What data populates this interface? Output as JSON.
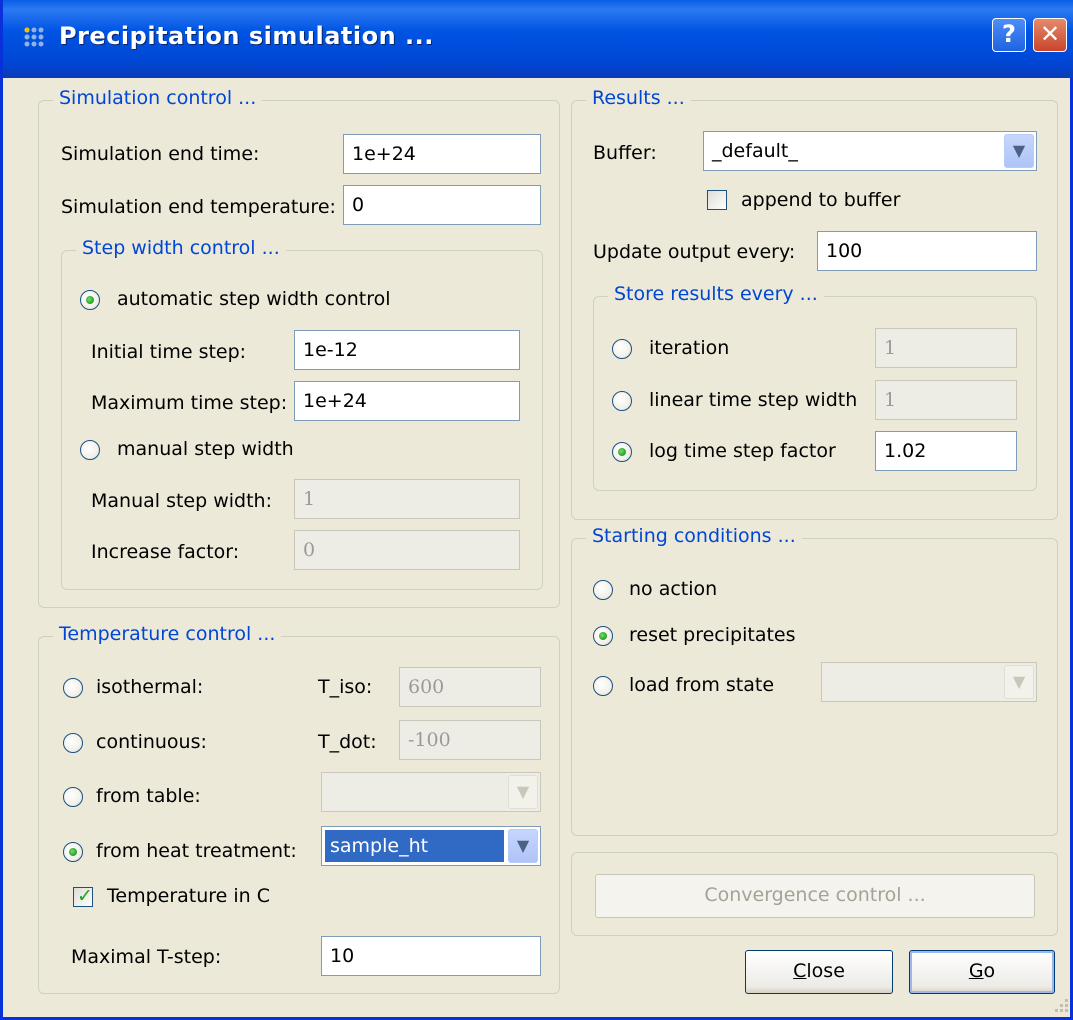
{
  "window": {
    "title": "Precipitation simulation ...",
    "help_label": "?",
    "close_label": "✕"
  },
  "simulation_control": {
    "legend": "Simulation control ...",
    "end_time_label": "Simulation end time:",
    "end_time_value": "1e+24",
    "end_temp_label": "Simulation end temperature:",
    "end_temp_value": "0"
  },
  "step_width_control": {
    "legend": "Step width control ...",
    "automatic_label": "automatic step width  control",
    "initial_step_label": "Initial time step:",
    "initial_step_value": "1e-12",
    "max_step_label": "Maximum time step:",
    "max_step_value": "1e+24",
    "manual_label": "manual step width",
    "manual_step_label": "Manual step width:",
    "manual_step_value": "1",
    "increase_label": "Increase factor:",
    "increase_value": "0",
    "selected": "automatic"
  },
  "temperature_control": {
    "legend": "Temperature control ...",
    "isothermal_label": "isothermal:",
    "t_iso_label": "T_iso:",
    "t_iso_value": "600",
    "continuous_label": "continuous:",
    "t_dot_label": "T_dot:",
    "t_dot_value": "-100",
    "from_table_label": "from table:",
    "from_table_value": "",
    "from_ht_label": "from heat treatment:",
    "from_ht_value": "sample_ht",
    "temp_in_c_label": "Temperature in C",
    "temp_in_c_checked": true,
    "max_tstep_label": "Maximal T-step:",
    "max_tstep_value": "10",
    "selected": "from_heat_treatment"
  },
  "results": {
    "legend": "Results ...",
    "buffer_label": "Buffer:",
    "buffer_value": "_default_",
    "append_label": "append to buffer",
    "append_checked": false,
    "update_label": "Update output every:",
    "update_value": "100"
  },
  "store_results": {
    "legend": "Store results every ...",
    "iteration_label": "iteration",
    "iteration_value": "1",
    "linear_label": "linear time step width",
    "linear_value": "1",
    "log_label": "log time step factor",
    "log_value": "1.02",
    "selected": "log"
  },
  "starting_conditions": {
    "legend": "Starting conditions ...",
    "no_action_label": "no action",
    "reset_label": "reset precipitates",
    "load_label": "load from state",
    "load_value": "",
    "selected": "reset"
  },
  "buttons": {
    "convergence_label": "Convergence control ...",
    "close_mnemonic": "C",
    "close_rest": "lose",
    "go_mnemonic": "G",
    "go_rest": "o"
  },
  "colors": {
    "accent": "#0046d5",
    "titlebar": "#0054e3",
    "dialog_bg": "#ece9d8",
    "selection": "#316ac5"
  }
}
